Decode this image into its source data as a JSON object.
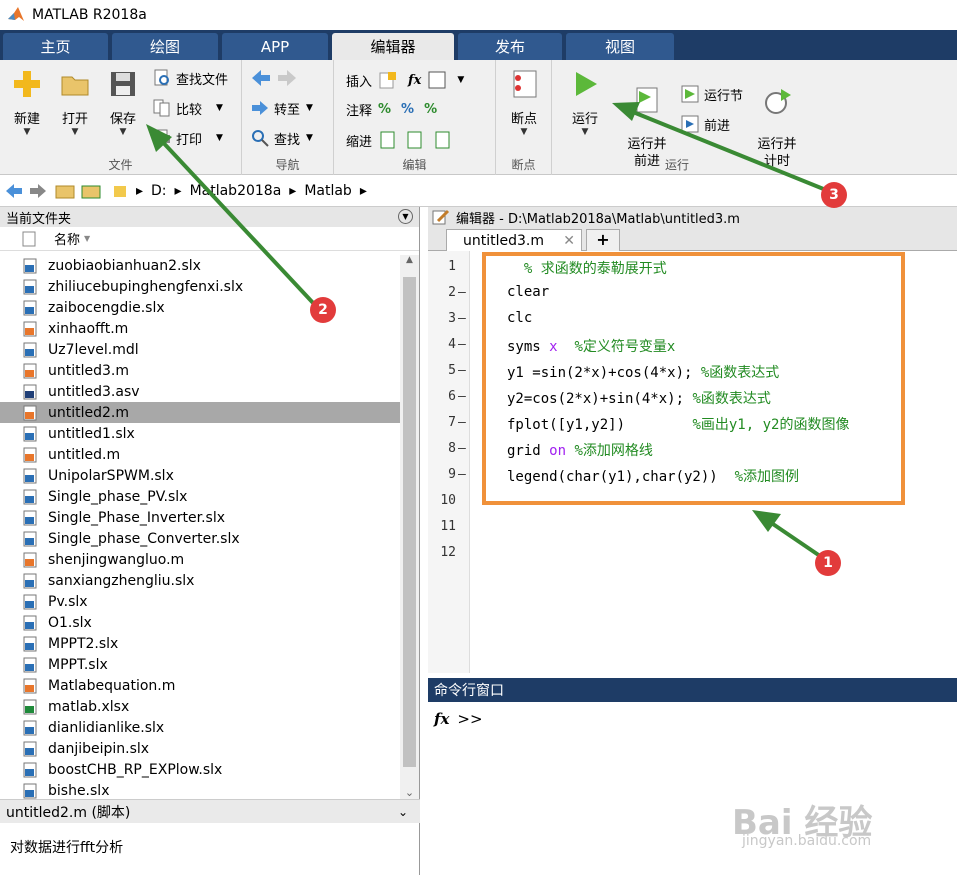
{
  "window": {
    "title": "MATLAB R2018a"
  },
  "tabs": [
    {
      "label": "主页"
    },
    {
      "label": "绘图"
    },
    {
      "label": "APP"
    },
    {
      "label": "编辑器"
    },
    {
      "label": "发布"
    },
    {
      "label": "视图"
    }
  ],
  "ribbon": {
    "file": {
      "group": "文件",
      "new": "新建",
      "open": "打开",
      "save": "保存",
      "find_files": "查找文件",
      "compare": "比较",
      "print": "打印"
    },
    "nav": {
      "group": "导航",
      "goto": "转至",
      "find": "查找"
    },
    "edit": {
      "group": "编辑",
      "insert": "插入",
      "comment": "注释",
      "indent": "缩进"
    },
    "bp": {
      "group": "断点",
      "breakpoints": "断点"
    },
    "run": {
      "group": "运行",
      "run": "运行",
      "run_advance": "运行并\n前进",
      "run_section": "运行节",
      "advance": "前进",
      "run_time": "运行并\n计时"
    }
  },
  "path": [
    "D:",
    "Matlab2018a",
    "Matlab"
  ],
  "current_folder": {
    "title": "当前文件夹",
    "col_name": "名称",
    "files": [
      "zuobiaobianhuan2.slx",
      "zhiliucebupinghengfenxi.slx",
      "zaibocengdie.slx",
      "xinhaofft.m",
      "Uz7level.mdl",
      "untitled3.m",
      "untitled3.asv",
      "untitled2.m",
      "untitled1.slx",
      "untitled.m",
      "UnipolarSPWM.slx",
      "Single_phase_PV.slx",
      "Single_Phase_Inverter.slx",
      "Single_phase_Converter.slx",
      "shenjingwangluo.m",
      "sanxiangzhengliu.slx",
      "Pv.slx",
      "O1.slx",
      "MPPT2.slx",
      "MPPT.slx",
      "Matlabequation.m",
      "matlab.xlsx",
      "dianlidianlike.slx",
      "danjibeipin.slx",
      "boostCHB_RP_EXPlow.slx",
      "bishe.slx"
    ],
    "types": [
      "slx",
      "slx",
      "slx",
      "m",
      "mdl",
      "m",
      "asv",
      "m",
      "slx",
      "m",
      "slx",
      "slx",
      "slx",
      "slx",
      "m",
      "slx",
      "slx",
      "slx",
      "slx",
      "slx",
      "m",
      "xlsx",
      "slx",
      "slx",
      "slx",
      "slx"
    ],
    "selected": "untitled2.m",
    "detail_title": "untitled2.m (脚本)",
    "detail_text": "对数据进行fft分析"
  },
  "editor": {
    "title": "编辑器 - D:\\Matlab2018a\\Matlab\\untitled3.m",
    "tab": "untitled3.m",
    "line_numbers": [
      "1",
      "2",
      "3",
      "4",
      "5",
      "6",
      "7",
      "8",
      "9",
      "10",
      "11",
      "12"
    ],
    "lines": [
      [
        {
          "t": "  % 求函数的泰勒展开式",
          "c": "cmt"
        }
      ],
      [
        {
          "t": "clear",
          "c": ""
        }
      ],
      [
        {
          "t": "clc",
          "c": ""
        }
      ],
      [
        {
          "t": "syms ",
          "c": ""
        },
        {
          "t": "x",
          "c": "kw"
        },
        {
          "t": "  %定义符号变量x",
          "c": "cmt"
        }
      ],
      [
        {
          "t": "y1 =sin(2*x)+cos(4*x); ",
          "c": ""
        },
        {
          "t": "%函数表达式",
          "c": "cmt"
        }
      ],
      [
        {
          "t": "y2=cos(2*x)+sin(4*x); ",
          "c": ""
        },
        {
          "t": "%函数表达式",
          "c": "cmt"
        }
      ],
      [
        {
          "t": "fplot([y1,y2])        ",
          "c": ""
        },
        {
          "t": "%画出y1, y2的函数图像",
          "c": "cmt"
        }
      ],
      [
        {
          "t": "grid ",
          "c": ""
        },
        {
          "t": "on",
          "c": "kw"
        },
        {
          "t": " %添加网格线",
          "c": "cmt"
        }
      ],
      [
        {
          "t": "legend(char(y1),char(y2))  ",
          "c": ""
        },
        {
          "t": "%添加图例",
          "c": "cmt"
        }
      ]
    ]
  },
  "command": {
    "title": "命令行窗口",
    "prompt": ">>"
  },
  "annotations": [
    "1",
    "2",
    "3"
  ],
  "watermark": {
    "brand": "Bai 经验",
    "url": "jingyan.baidu.com"
  }
}
